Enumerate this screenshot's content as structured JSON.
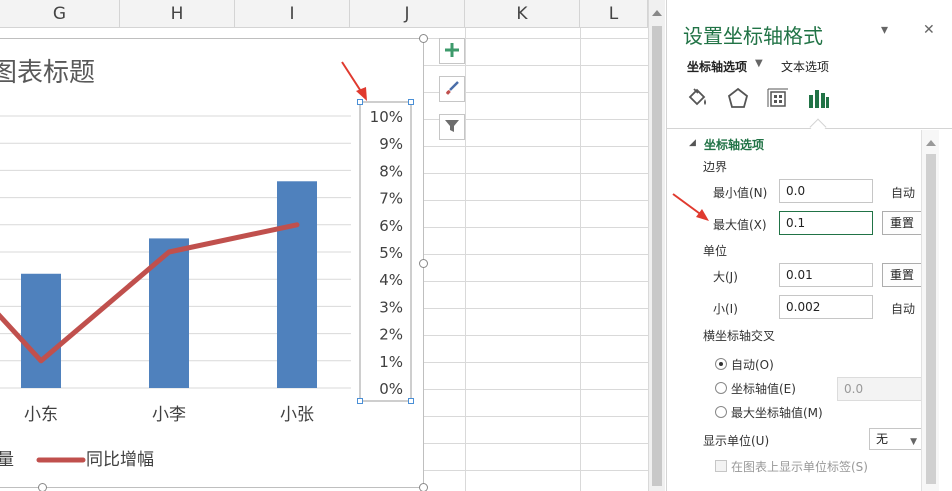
{
  "sheet": {
    "columns": [
      "G",
      "H",
      "I",
      "J",
      "K",
      "L"
    ]
  },
  "chart": {
    "title": "图表标题",
    "categories": [
      "小东",
      "小李",
      "小张"
    ],
    "axis_ticks": [
      "10%",
      "9%",
      "8%",
      "7%",
      "6%",
      "5%",
      "4%",
      "3%",
      "2%",
      "1%",
      "0%"
    ],
    "legend": {
      "bar_series_partial": "量",
      "line_series": "同比增幅"
    },
    "colors": {
      "bar": "#4f81bd",
      "line": "#c0504d"
    },
    "side_buttons": [
      "plus-icon",
      "brush-icon",
      "filter-icon"
    ]
  },
  "chart_data": {
    "type": "bar",
    "categories": [
      "小东",
      "小李",
      "小张"
    ],
    "series": [
      {
        "values": [
          0.042,
          0.055,
          0.076
        ],
        "type": "bar"
      },
      {
        "name": "同比增幅",
        "values": [
          0.01,
          0.05,
          0.06
        ],
        "type": "line"
      }
    ],
    "secondary_axis_ticks": [
      "0%",
      "1%",
      "2%",
      "3%",
      "4%",
      "5%",
      "6%",
      "7%",
      "8%",
      "9%",
      "10%"
    ],
    "title": "图表标题",
    "ylim": [
      0,
      0.1
    ],
    "grid": true,
    "legend": "bottom"
  },
  "pane": {
    "title": "设置坐标轴格式",
    "tab_axis_options": "坐标轴选项",
    "tab_text_options": "文本选项",
    "icons": [
      "fill-icon",
      "pentagon-icon",
      "size-properties-icon",
      "bar-chart-icon"
    ],
    "section_title": "坐标轴选项",
    "bounds": {
      "heading": "边界",
      "min_label": "最小值(N)",
      "min_value": "0.0",
      "min_state": "自动",
      "max_label": "最大值(X)",
      "max_value": "0.1",
      "max_reset": "重置"
    },
    "units": {
      "heading": "单位",
      "major_label": "大(J)",
      "major_value": "0.01",
      "major_reset": "重置",
      "minor_label": "小(I)",
      "minor_value": "0.002",
      "minor_state": "自动"
    },
    "crosses": {
      "heading": "横坐标轴交叉",
      "auto": "自动(O)",
      "axis_value": "坐标轴值(E)",
      "axis_value_input": "0.0",
      "max_axis": "最大坐标轴值(M)"
    },
    "display_units": {
      "label": "显示单位(U)",
      "value": "无",
      "show_label": "在图表上显示单位标签(S)"
    }
  }
}
